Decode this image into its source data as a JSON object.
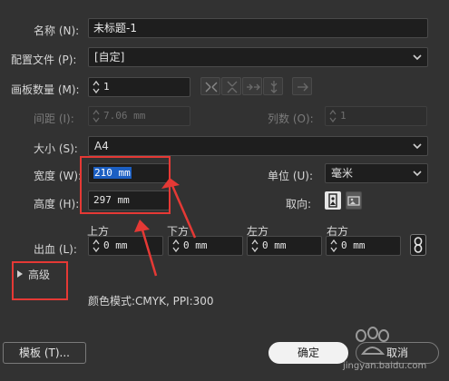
{
  "name": {
    "label": "名称 (N):",
    "value": "未标题-1"
  },
  "profile": {
    "label": "配置文件 (P):",
    "value": "[自定]"
  },
  "artboards": {
    "label": "画板数量 (M):",
    "value": "1"
  },
  "spacing": {
    "label": "间距 (I):",
    "value": "7.06 mm"
  },
  "columns": {
    "label": "列数 (O):",
    "value": "1"
  },
  "size": {
    "label": "大小 (S):",
    "value": "A4"
  },
  "width": {
    "label": "宽度 (W):",
    "value": "210 mm"
  },
  "height": {
    "label": "高度 (H):",
    "value": "297 mm"
  },
  "units": {
    "label": "单位 (U):",
    "value": "毫米"
  },
  "orientation": {
    "label": "取向:"
  },
  "bleed": {
    "label": "出血 (L):",
    "top": {
      "label": "上方",
      "value": "0 mm"
    },
    "bottom": {
      "label": "下方",
      "value": "0 mm"
    },
    "left": {
      "label": "左方",
      "value": "0 mm"
    },
    "right": {
      "label": "右方",
      "value": "0 mm"
    }
  },
  "advanced": {
    "label": "高级"
  },
  "color_mode": "颜色模式:CMYK, PPI:300",
  "buttons": {
    "templates": "模板 (T)...",
    "ok": "确定",
    "cancel": "取消"
  },
  "watermark": "jingyan.baidu.com",
  "colors": {
    "annotation": "#e53935",
    "selection": "#1c5fc2",
    "background": "#323232"
  }
}
